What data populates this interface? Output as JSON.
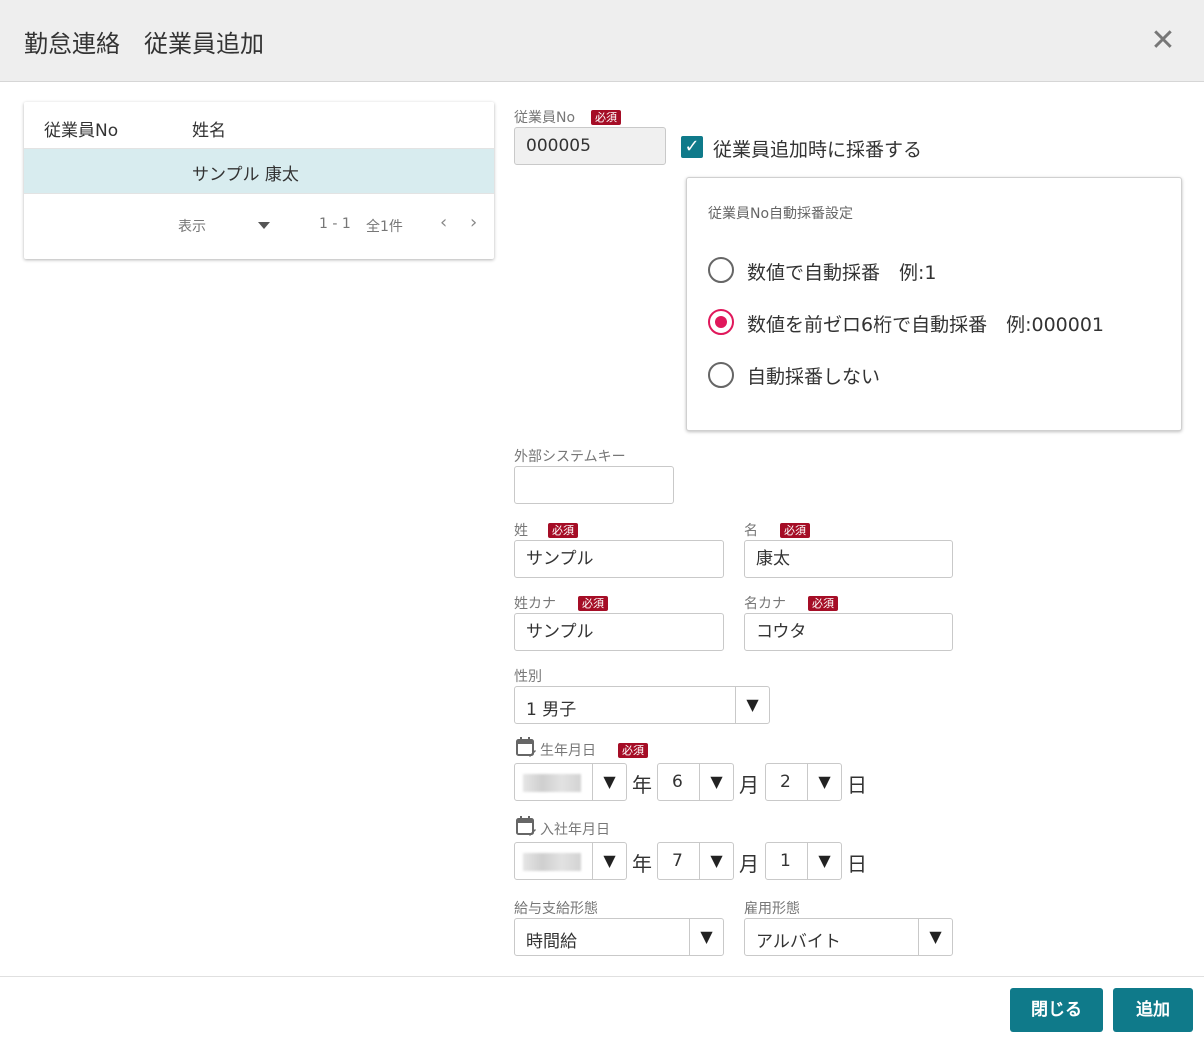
{
  "header": {
    "title": "勤怠連絡　従業員追加",
    "close_icon": "close-icon"
  },
  "list": {
    "columns": [
      "従業員No",
      "姓名"
    ],
    "rows": [
      {
        "no": "",
        "name": "サンプル 康太"
      }
    ],
    "display_label": "表示",
    "range": "1 - 1",
    "total": "全1件",
    "prev": "‹",
    "next": "›"
  },
  "form": {
    "required_badge": "必須",
    "employee_no": {
      "label": "従業員No",
      "value": "000005"
    },
    "auto_number": {
      "label": "従業員追加時に採番する",
      "checked": true
    },
    "auto_panel": {
      "title": "従業員No自動採番設定",
      "options": [
        {
          "label": "数値で自動採番　例:1",
          "selected": false
        },
        {
          "label": "数値を前ゼロ6桁で自動採番　例:000001",
          "selected": true
        },
        {
          "label": "自動採番しない",
          "selected": false
        }
      ]
    },
    "external_key": {
      "label": "外部システムキー",
      "value": ""
    },
    "last_name": {
      "label": "姓",
      "value": "サンプル"
    },
    "first_name": {
      "label": "名",
      "value": "康太"
    },
    "last_kana": {
      "label": "姓カナ",
      "value": "サンプル"
    },
    "first_kana": {
      "label": "名カナ",
      "value": "コウタ"
    },
    "gender": {
      "label": "性別",
      "value": "1 男子"
    },
    "birth": {
      "label": "生年月日",
      "month": "6",
      "day": "2"
    },
    "hire": {
      "label": "入社年月日",
      "month": "7",
      "day": "1"
    },
    "units": {
      "year": "年",
      "month": "月",
      "day": "日"
    },
    "pay_type": {
      "label": "給与支給形態",
      "value": "時間給"
    },
    "employment": {
      "label": "雇用形態",
      "value": "アルバイト"
    },
    "arrow": "▼"
  },
  "footer": {
    "close_label": "閉じる",
    "add_label": "追加"
  },
  "colors": {
    "accent": "#0f7a8a",
    "required": "#a50d26",
    "radio": "#e0185b",
    "selected_row": "#d8ecef"
  }
}
